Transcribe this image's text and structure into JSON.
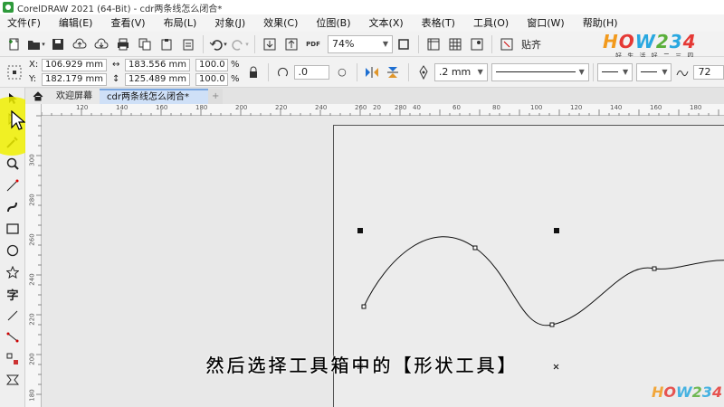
{
  "app": {
    "title": "CorelDRAW 2021 (64-Bit) - cdr两条线怎么闭合*"
  },
  "menu": [
    "文件(F)",
    "编辑(E)",
    "查看(V)",
    "布局(L)",
    "对象(J)",
    "效果(C)",
    "位图(B)",
    "文本(X)",
    "表格(T)",
    "工具(O)",
    "窗口(W)",
    "帮助(H)"
  ],
  "toolbar": {
    "zoom": "74%",
    "snap_label": "贴齐"
  },
  "props": {
    "x": "106.929 mm",
    "y": "182.179 mm",
    "width": "183.556 mm",
    "height": "125.489 mm",
    "scale_w": "100.0",
    "scale_h": "100.0",
    "pct": "%",
    "x_label": "X:",
    "y_label": "Y:",
    "angle": ".0",
    "outline_width": ".2 mm",
    "smooth": "72"
  },
  "tabs": {
    "home": "欢迎屏幕",
    "doc": "cdr两条线怎么闭合*",
    "add": "+"
  },
  "ruler": {
    "h": [
      "120",
      "140",
      "160",
      "180",
      "200",
      "220",
      "240",
      "260",
      "280",
      "0",
      "20",
      "40",
      "60",
      "80",
      "100",
      "120",
      "140",
      "160",
      "180"
    ],
    "v": [
      "300",
      "280",
      "260",
      "240",
      "220",
      "200",
      "180"
    ]
  },
  "logo": {
    "text": "HOW234",
    "sub": "好 生 活 好 二 三 四"
  },
  "caption": "然后选择工具箱中的【形状工具】"
}
